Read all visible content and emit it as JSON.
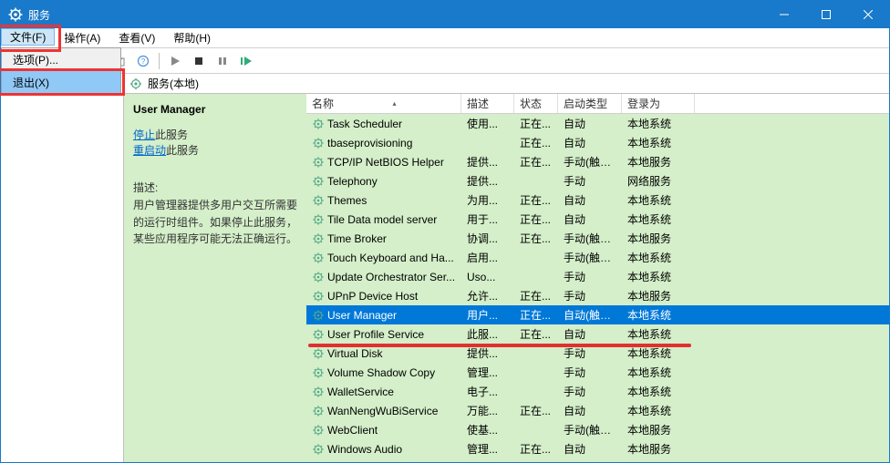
{
  "title": "服务",
  "menubar": [
    "文件(F)",
    "操作(A)",
    "查看(V)",
    "帮助(H)"
  ],
  "file_menu": {
    "options": "选项(P)...",
    "exit": "退出(X)"
  },
  "sidebar": {
    "root": "服务(本地)"
  },
  "detail_header": "服务(本地)",
  "detail": {
    "title": "User Manager",
    "stop": "停止",
    "restart": "重启动",
    "service_suffix": "此服务",
    "desc_label": "描述:",
    "desc": "用户管理器提供多用户交互所需要的运行时组件。如果停止此服务，某些应用程序可能无法正确运行。"
  },
  "columns": {
    "name": "名称",
    "desc": "描述",
    "state": "状态",
    "startup": "启动类型",
    "logon": "登录为"
  },
  "rows": [
    {
      "name": "Task Scheduler",
      "desc": "使用...",
      "state": "正在...",
      "startup": "自动",
      "logon": "本地系统"
    },
    {
      "name": "tbaseprovisioning",
      "desc": "",
      "state": "正在...",
      "startup": "自动",
      "logon": "本地系统"
    },
    {
      "name": "TCP/IP NetBIOS Helper",
      "desc": "提供...",
      "state": "正在...",
      "startup": "手动(触发...",
      "logon": "本地服务"
    },
    {
      "name": "Telephony",
      "desc": "提供...",
      "state": "",
      "startup": "手动",
      "logon": "网络服务"
    },
    {
      "name": "Themes",
      "desc": "为用...",
      "state": "正在...",
      "startup": "自动",
      "logon": "本地系统"
    },
    {
      "name": "Tile Data model server",
      "desc": "用于...",
      "state": "正在...",
      "startup": "自动",
      "logon": "本地系统"
    },
    {
      "name": "Time Broker",
      "desc": "协调...",
      "state": "正在...",
      "startup": "手动(触发...",
      "logon": "本地服务"
    },
    {
      "name": "Touch Keyboard and Ha...",
      "desc": "启用...",
      "state": "",
      "startup": "手动(触发...",
      "logon": "本地系统"
    },
    {
      "name": "Update Orchestrator Ser...",
      "desc": "Uso...",
      "state": "",
      "startup": "手动",
      "logon": "本地系统"
    },
    {
      "name": "UPnP Device Host",
      "desc": "允许...",
      "state": "正在...",
      "startup": "手动",
      "logon": "本地服务"
    },
    {
      "name": "User Manager",
      "desc": "用户...",
      "state": "正在...",
      "startup": "自动(触发...",
      "logon": "本地系统",
      "selected": true
    },
    {
      "name": "User Profile Service",
      "desc": "此服...",
      "state": "正在...",
      "startup": "自动",
      "logon": "本地系统"
    },
    {
      "name": "Virtual Disk",
      "desc": "提供...",
      "state": "",
      "startup": "手动",
      "logon": "本地系统"
    },
    {
      "name": "Volume Shadow Copy",
      "desc": "管理...",
      "state": "",
      "startup": "手动",
      "logon": "本地系统"
    },
    {
      "name": "WalletService",
      "desc": "电子...",
      "state": "",
      "startup": "手动",
      "logon": "本地系统"
    },
    {
      "name": "WanNengWuBiService",
      "desc": "万能...",
      "state": "正在...",
      "startup": "自动",
      "logon": "本地系统"
    },
    {
      "name": "WebClient",
      "desc": "使基...",
      "state": "",
      "startup": "手动(触发...",
      "logon": "本地服务"
    },
    {
      "name": "Windows Audio",
      "desc": "管理...",
      "state": "正在...",
      "startup": "自动",
      "logon": "本地服务"
    }
  ]
}
